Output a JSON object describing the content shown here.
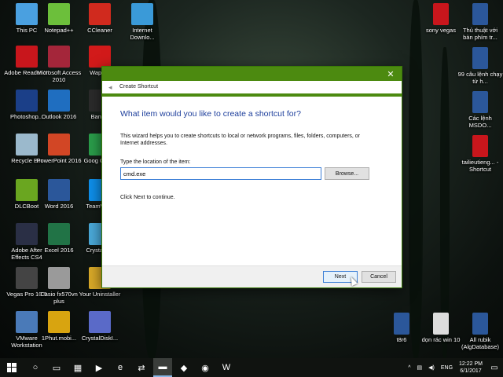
{
  "desktop": {
    "icons_left": [
      {
        "label": "This PC",
        "icon": "computer-icon",
        "color": "#4aa0e0"
      },
      {
        "label": "Notepad++",
        "icon": "notepad-icon",
        "color": "#6cbf3b"
      },
      {
        "label": "CCleaner",
        "icon": "ccleaner-icon",
        "color": "#d02a1e"
      },
      {
        "label": "Internet Downlo...",
        "icon": "idm-icon",
        "color": "#3a9ad8"
      },
      {
        "label": "Adobe Reader XI",
        "icon": "pdf-icon",
        "color": "#c8161c"
      },
      {
        "label": "Microsoft Access 2010",
        "icon": "access-icon",
        "color": "#a4263a"
      },
      {
        "label": "WapVip",
        "icon": "wapvip-icon",
        "color": "#d21a1a"
      },
      {
        "label": "Photoshop...",
        "icon": "photoshop-icon",
        "color": "#1b3f88"
      },
      {
        "label": "Outlook 2016",
        "icon": "outlook-icon",
        "color": "#1f6ec0"
      },
      {
        "label": "Bandic",
        "icon": "bandicam-icon",
        "color": "#2b2b2b"
      },
      {
        "label": "Recycle Bin",
        "icon": "recycle-bin-icon",
        "color": "#9bb9cc"
      },
      {
        "label": "PowerPoint 2016",
        "icon": "powerpoint-icon",
        "color": "#d24625"
      },
      {
        "label": "Goog Chron",
        "icon": "chrome-icon",
        "color": "#2a9d4a"
      },
      {
        "label": "DLCBoot",
        "icon": "dlcboot-icon",
        "color": "#6aa620"
      },
      {
        "label": "Word 2016",
        "icon": "word-icon",
        "color": "#2b579a"
      },
      {
        "label": "TeamVi 12",
        "icon": "teamviewer-icon",
        "color": "#0e8ee9"
      },
      {
        "label": "Adobe After Effects CS4",
        "icon": "after-effects-icon",
        "color": "#2a2f45"
      },
      {
        "label": "Excel 2016",
        "icon": "excel-icon",
        "color": "#217346"
      },
      {
        "label": "CrystalD 5",
        "icon": "crystaldisk-icon",
        "color": "#4aa8d8"
      },
      {
        "label": "Vegas Pro 10.0",
        "icon": "vegas-icon",
        "color": "#444444"
      },
      {
        "label": "Casio fx570vn plus",
        "icon": "calculator-icon",
        "color": "#9a9a9a"
      },
      {
        "label": "Your Uninstaller",
        "icon": "uninstaller-icon",
        "color": "#d8a828"
      },
      {
        "label": "VMware Workstation",
        "icon": "vmware-icon",
        "color": "#4a7ab8"
      },
      {
        "label": "1Phut.mobi...",
        "icon": "1phut-icon",
        "color": "#d8a410"
      },
      {
        "label": "CrystalDiskI...",
        "icon": "crystaldiskinfo-icon",
        "color": "#5a6ac8"
      }
    ],
    "icons_right": [
      {
        "label": "sony vegas",
        "icon": "pdf-icon",
        "color": "#c8161c"
      },
      {
        "label": "Thủ thuật với bàn phím tr...",
        "icon": "word-doc-icon",
        "color": "#2b579a"
      },
      {
        "label": "99 câu lệnh chạy từ h...",
        "icon": "word-doc-icon",
        "color": "#2b579a"
      },
      {
        "label": "Các lệnh MSDO...",
        "icon": "word-doc-icon",
        "color": "#2b579a"
      },
      {
        "label": "tailieutieng... - Shortcut",
        "icon": "pdf-icon",
        "color": "#c8161c"
      },
      {
        "label": "t8r6",
        "icon": "word-doc-icon",
        "color": "#2b579a"
      },
      {
        "label": "dọn rác win 10",
        "icon": "text-file-icon",
        "color": "#dddddd"
      },
      {
        "label": "All rubik (AlgDatabase)",
        "icon": "word-doc-icon",
        "color": "#2b579a"
      }
    ]
  },
  "dialog": {
    "window_title": "Create Shortcut",
    "heading": "What item would you like to create a shortcut for?",
    "description": "This wizard helps you to create shortcuts to local or network programs, files, folders, computers, or Internet addresses.",
    "location_label": "Type the location of the item:",
    "location_value": "cmd.exe",
    "browse_label": "Browse...",
    "hint": "Click Next to continue.",
    "next_label": "Next",
    "cancel_label": "Cancel",
    "close_glyph": "✕",
    "accent": "#4c8a10"
  },
  "taskbar": {
    "language": "ENG",
    "time": "12:22 PM",
    "date": "6/1/2017",
    "pinned": [
      {
        "icon": "cortana-icon",
        "glyph": "○"
      },
      {
        "icon": "task-view-icon",
        "glyph": "▭"
      },
      {
        "icon": "store-icon",
        "glyph": "▦"
      },
      {
        "icon": "media-player-icon",
        "glyph": "▶"
      },
      {
        "icon": "edge-icon",
        "glyph": "e"
      },
      {
        "icon": "teamviewer-icon",
        "glyph": "⇄"
      },
      {
        "icon": "file-explorer-icon",
        "glyph": "▬"
      },
      {
        "icon": "ccleaner-icon",
        "glyph": "◆"
      },
      {
        "icon": "chrome-icon",
        "glyph": "◉"
      },
      {
        "icon": "word-icon",
        "glyph": "W"
      }
    ]
  }
}
